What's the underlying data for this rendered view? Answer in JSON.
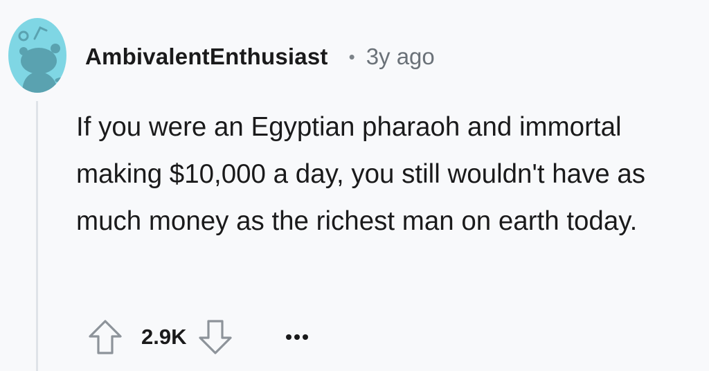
{
  "comment": {
    "author": "AmbivalentEnthusiast",
    "separator": "•",
    "timestamp": "3y ago",
    "body": "If you were an Egyptian pharaoh and immortal making $10,000 a day, you still wouldn't have as much money as the richest man on earth today.",
    "score": "2.9K"
  },
  "icons": {
    "avatar": "snoo-avatar-icon",
    "upvote": "upvote-arrow-icon",
    "downvote": "downvote-arrow-icon",
    "more": "more-options-icon"
  },
  "colors": {
    "background": "#f8f9fb",
    "avatar_bg": "#7fd6e4",
    "avatar_figure": "#5aa2b0",
    "text_primary": "#1a1a1b",
    "text_secondary": "#6a7178",
    "thread_line": "#dfe3e8",
    "icon_gray": "#8d939a"
  }
}
